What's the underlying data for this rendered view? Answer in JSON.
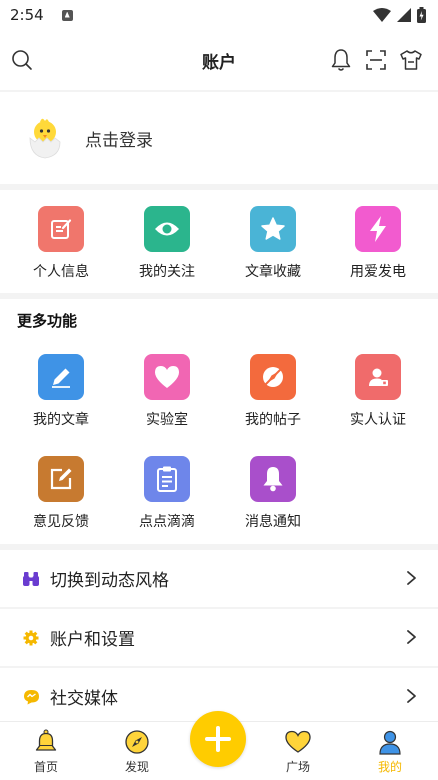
{
  "status": {
    "time": "2:54"
  },
  "header": {
    "title": "账户"
  },
  "login": {
    "label": "点击登录"
  },
  "quick_actions": [
    {
      "label": "个人信息",
      "icon": "edit-icon",
      "color": "#f0766c"
    },
    {
      "label": "我的关注",
      "icon": "eye-icon",
      "color": "#2bb58d"
    },
    {
      "label": "文章收藏",
      "icon": "star-icon",
      "color": "#4ab4d6"
    },
    {
      "label": "用爱发电",
      "icon": "lightning-icon",
      "color": "#f25bcf"
    }
  ],
  "more": {
    "title": "更多功能",
    "items": [
      {
        "label": "我的文章",
        "icon": "pencil-icon",
        "color": "#3f93e6"
      },
      {
        "label": "实验室",
        "icon": "heart-icon",
        "color": "#f166b3"
      },
      {
        "label": "我的帖子",
        "icon": "compass-icon",
        "color": "#f36a3d"
      },
      {
        "label": "实人认证",
        "icon": "id-card-icon",
        "color": "#f06b6b"
      },
      {
        "label": "意见反馈",
        "icon": "feedback-icon",
        "color": "#c77a30"
      },
      {
        "label": "点点滴滴",
        "icon": "clipboard-icon",
        "color": "#6e86ea"
      },
      {
        "label": "消息通知",
        "icon": "bell-icon",
        "color": "#a94fcb"
      }
    ]
  },
  "settings": [
    {
      "label": "切换到动态风格",
      "icon": "binoculars-icon",
      "color": "#6a3cd0"
    },
    {
      "label": "账户和设置",
      "icon": "gear-icon",
      "color": "#f5b800"
    },
    {
      "label": "社交媒体",
      "icon": "chat-icon",
      "color": "#f5b800"
    }
  ],
  "nav": [
    {
      "label": "首页",
      "icon": "bell-icon"
    },
    {
      "label": "发现",
      "icon": "compass-icon"
    },
    {
      "label": "广场",
      "icon": "heart-icon"
    },
    {
      "label": "我的",
      "icon": "person-icon",
      "active": true
    }
  ],
  "colors": {
    "accent": "#ffcc00",
    "active": "#f5b800"
  }
}
